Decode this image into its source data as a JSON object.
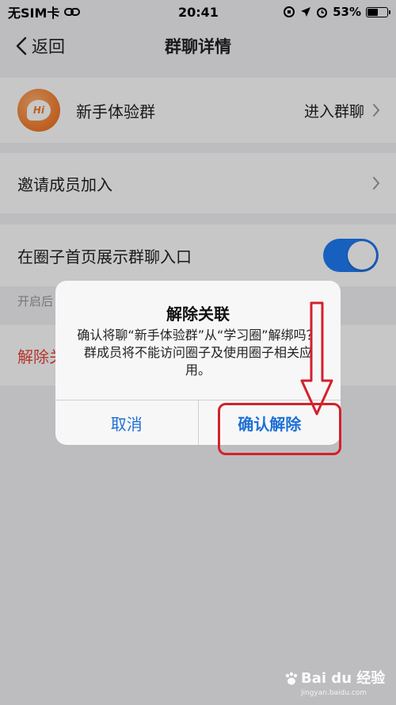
{
  "status_bar": {
    "carrier": "无SIM卡",
    "time": "20:41",
    "battery": "53%"
  },
  "nav": {
    "back_label": "返回",
    "title": "群聊详情"
  },
  "group_row": {
    "name": "新手体验群",
    "action_label": "进入群聊"
  },
  "invite_row": {
    "label": "邀请成员加入"
  },
  "toggle_row": {
    "label": "在圈子首页展示群聊入口",
    "enabled": true
  },
  "hint_text": "开启后",
  "unbind_row": {
    "label": "解除关"
  },
  "dialog": {
    "title": "解除关联",
    "message": "确认将聊“新手体验群”从“学习圈”解绑吗？群成员将不能访问圈子及使用圈子相关应用。",
    "cancel_label": "取消",
    "confirm_label": "确认解除"
  },
  "watermark": {
    "brand": "Bai du 经验",
    "site": "jingyan.baidu.com"
  },
  "colors": {
    "accent": "#1e70d6",
    "toggle_on": "#1f7cf5",
    "danger": "#e8453c",
    "annotation": "#d4202c"
  }
}
